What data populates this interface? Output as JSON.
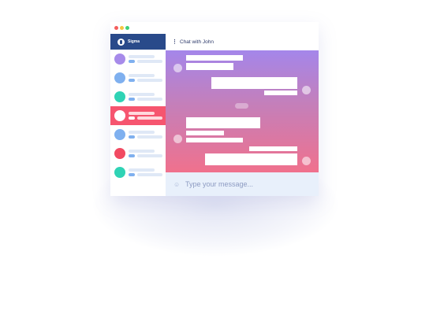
{
  "colors": {
    "brand_bg": "#294a8a",
    "active_row": "#f6556f",
    "dot_red": "#f45d5d",
    "dot_yellow": "#f5c542",
    "dot_green": "#3ecf7a"
  },
  "sidebar": {
    "brand_name": "Sigma",
    "contacts": [
      {
        "avatar_color": "#a78bea",
        "active": false
      },
      {
        "avatar_color": "#7fb0ef",
        "active": false
      },
      {
        "avatar_color": "#2fd3b5",
        "active": false
      },
      {
        "avatar_color": "#ffffff",
        "active": true
      },
      {
        "avatar_color": "#7fb0ef",
        "active": false
      },
      {
        "avatar_color": "#f14a62",
        "active": false
      },
      {
        "avatar_color": "#2fd3b5",
        "active": false
      }
    ]
  },
  "chat": {
    "title": "Chat with John"
  },
  "composer": {
    "placeholder": "Type your message..."
  },
  "icons": {
    "menu": "more-vertical-icon",
    "emoji": "smile-icon",
    "logo": "sigma-logo-icon"
  }
}
